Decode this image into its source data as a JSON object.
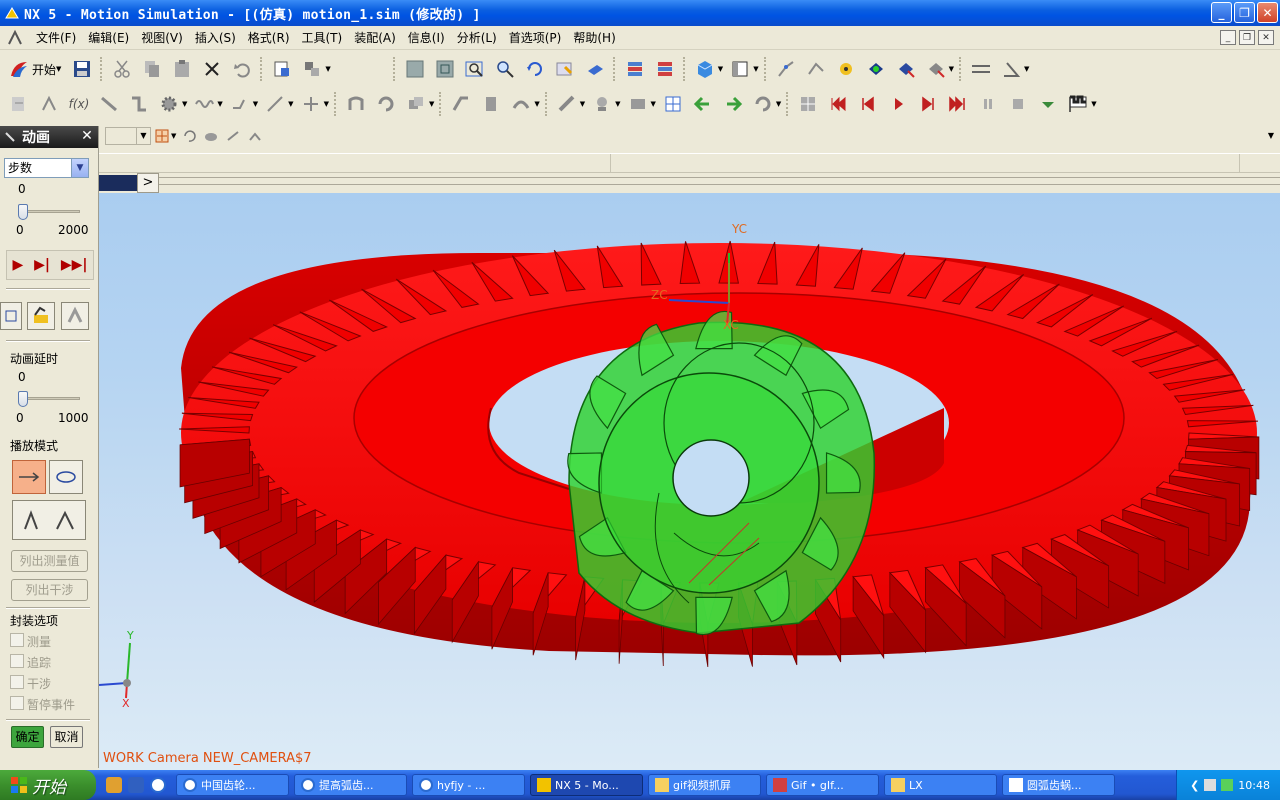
{
  "window": {
    "title": "NX 5 - Motion Simulation - [(仿真) motion_1.sim (修改的) ]"
  },
  "menu": [
    "文件(F)",
    "编辑(E)",
    "视图(V)",
    "插入(S)",
    "格式(R)",
    "工具(T)",
    "装配(A)",
    "信息(I)",
    "分析(L)",
    "首选项(P)",
    "帮助(H)"
  ],
  "toolbar": {
    "start_label": "开始"
  },
  "animation_panel": {
    "title": "动画",
    "mode_select": "步数",
    "steps_value": "0",
    "steps_min": "0",
    "steps_max": "2000",
    "steps_level": 0,
    "delay_label": "动画延时",
    "delay_value": "0",
    "delay_min": "0",
    "delay_max": "1000",
    "delay_level": 0,
    "playback_mode_label": "播放模式",
    "list_measurements_button": "列出测量值",
    "list_interference_button": "列出干涉",
    "package_options_label": "封装选项",
    "options": [
      "测量",
      "追踪",
      "干涉",
      "暂停事件"
    ],
    "ok_button": "确定",
    "cancel_button": "取消"
  },
  "viewport": {
    "camera_label": "WORK Camera NEW_CAMERA$7",
    "wcs_labels": {
      "yc": "YC",
      "zc": "ZC",
      "xc": "XC"
    },
    "triad_labels": {
      "y": "Y",
      "x": "X"
    },
    "colors": {
      "ring_gear": "#ff0000",
      "pinion": "#2fd22f",
      "wcs_axis": "#e06a20"
    }
  },
  "taskbar": {
    "start_label": "开始",
    "tasks": [
      {
        "label": "中国齿轮...",
        "active": false
      },
      {
        "label": "提高弧齿...",
        "active": false
      },
      {
        "label": "hyfjy - ...",
        "active": false
      },
      {
        "label": "NX 5 - Mo...",
        "active": true
      },
      {
        "label": "gif视频抓屏",
        "active": false
      },
      {
        "label": "Gif • gIf...",
        "active": false
      },
      {
        "label": "LX",
        "active": false
      },
      {
        "label": "圆弧齿蜗...",
        "active": false
      }
    ],
    "clock": "10:48"
  }
}
